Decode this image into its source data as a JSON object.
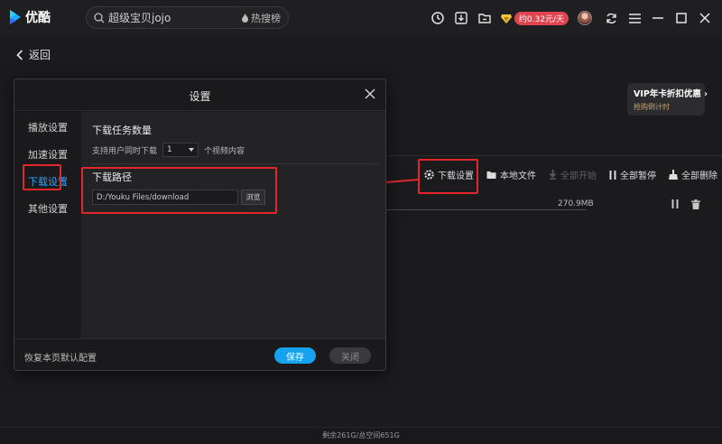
{
  "app": {
    "name": "优酷"
  },
  "search": {
    "value": "超级宝贝jojo",
    "hot_label": "热搜榜"
  },
  "topbar": {
    "vip_badge": "约0.32元/天"
  },
  "nav": {
    "back_label": "返回"
  },
  "promo": {
    "title": "VIP年卡折扣优惠 ›",
    "subtitle": "抢购倒计时"
  },
  "download_toolbar": {
    "settings": "下载设置",
    "local_files": "本地文件",
    "start_all": "全部开始",
    "pause_all": "全部暂停",
    "delete_all": "全部删除"
  },
  "download_item": {
    "size": "270.9MB"
  },
  "settings_modal": {
    "title": "设置",
    "nav": [
      "播放设置",
      "加速设置",
      "下载设置",
      "其他设置"
    ],
    "task_count": {
      "title": "下载任务数量",
      "prefix": "支持用户同时下载",
      "value": "1",
      "suffix": "个视频内容"
    },
    "path": {
      "title": "下载路径",
      "value": "D:/Youku Files/download",
      "browse": "浏览"
    },
    "footer": {
      "restore": "恢复本页默认配置",
      "save": "保存",
      "close": "关闭"
    }
  },
  "status": {
    "text": "剩余261G/总空间651G"
  },
  "colors": {
    "accent": "#16a2f0",
    "highlight": "#e3262c",
    "vip": "#e0454f"
  }
}
